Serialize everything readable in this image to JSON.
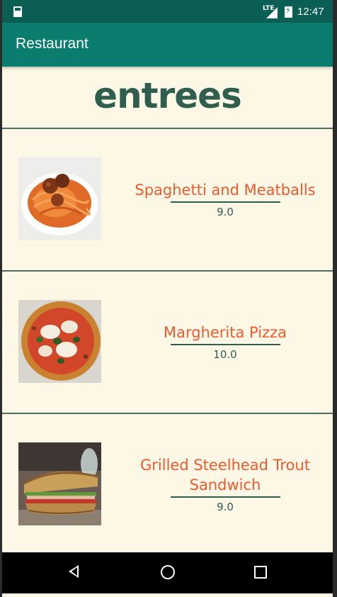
{
  "status_bar": {
    "network": "LTE",
    "time": "12:47"
  },
  "app_bar": {
    "title": "Restaurant"
  },
  "section": {
    "heading": "entrees"
  },
  "items": [
    {
      "name": "Spaghetti and Meatballs",
      "price": "9.0",
      "image": "spaghetti-meatballs-photo"
    },
    {
      "name": "Margherita Pizza",
      "price": "10.0",
      "image": "margherita-pizza-photo"
    },
    {
      "name": "Grilled Steelhead Trout Sandwich",
      "price": "9.0",
      "image": "trout-sandwich-photo"
    }
  ],
  "colors": {
    "status_bar": "#0a5e53",
    "app_bar": "#0a7d6e",
    "background": "#fdf8e6",
    "heading": "#2f5d4e",
    "item_name": "#ee5a30",
    "price": "#2f5d4e"
  },
  "nav_bar": {
    "icons": [
      "back-icon",
      "home-icon",
      "recents-icon"
    ]
  }
}
